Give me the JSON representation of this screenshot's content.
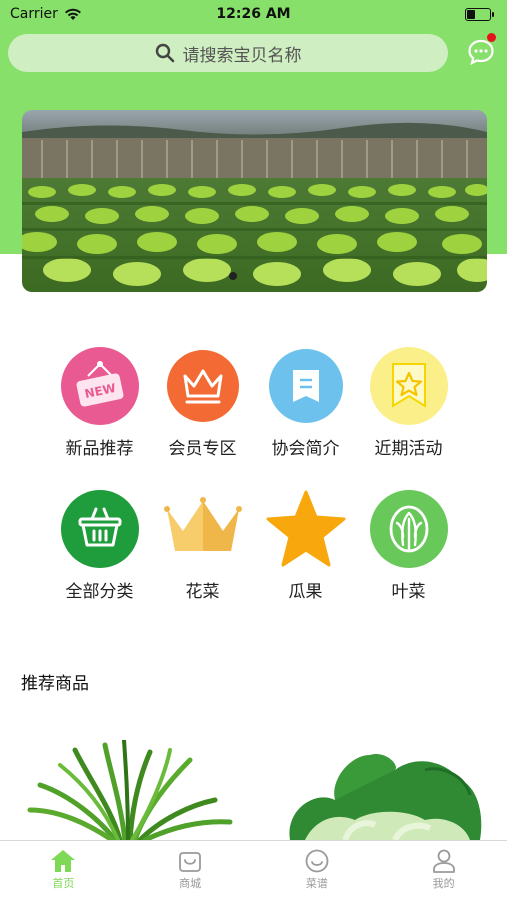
{
  "status_bar": {
    "carrier": "Carrier",
    "time": "12:26 AM"
  },
  "search": {
    "placeholder": "请搜索宝贝名称",
    "has_notification": true
  },
  "banner": {
    "current_slide": 1
  },
  "categories": [
    {
      "label": "新品推荐",
      "icon": "new-badge-icon",
      "color": "#ea5a92"
    },
    {
      "label": "会员专区",
      "icon": "crown-icon",
      "color": "#f36a34"
    },
    {
      "label": "协会简介",
      "icon": "bookmark-icon",
      "color": "#6cc2ec"
    },
    {
      "label": "近期活动",
      "icon": "star-flag-icon",
      "color": "#fbef8a"
    },
    {
      "label": "全部分类",
      "icon": "basket-icon",
      "color": "#1f9d3d"
    },
    {
      "label": "花菜",
      "icon": "crown-yellow-icon",
      "color": "#f6cd6a"
    },
    {
      "label": "瓜果",
      "icon": "star-icon",
      "color": "#f8a70d"
    },
    {
      "label": "叶菜",
      "icon": "leaf-vegetable-icon",
      "color": "#69c85a"
    }
  ],
  "section": {
    "title": "推荐商品"
  },
  "tabbar": {
    "tabs": [
      {
        "label": "首页",
        "icon": "home-icon",
        "active": true
      },
      {
        "label": "商城",
        "icon": "shopping-bag-icon",
        "active": false
      },
      {
        "label": "菜谱",
        "icon": "smile-icon",
        "active": false
      },
      {
        "label": "我的",
        "icon": "user-icon",
        "active": false
      }
    ],
    "active_color": "#7ed957"
  },
  "colors": {
    "header_green": "#86e06a",
    "search_bg": "#cfeec1"
  }
}
